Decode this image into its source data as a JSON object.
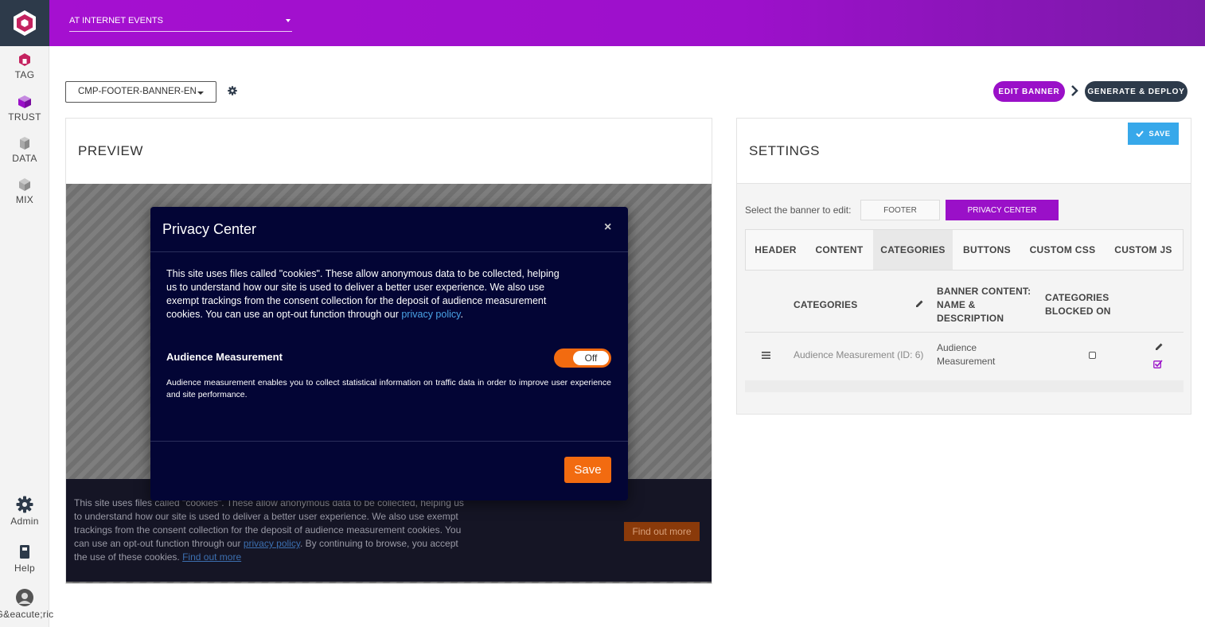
{
  "sidebar": {
    "items": [
      {
        "label": "TAG",
        "icon": "tag-hexagon-icon",
        "color": "#c4225f"
      },
      {
        "label": "TRUST",
        "icon": "trust-cube-icon",
        "color": "#9a10c8"
      },
      {
        "label": "DATA",
        "icon": "data-cube-icon",
        "color": "#999999"
      },
      {
        "label": "MIX",
        "icon": "mix-cube-icon",
        "color": "#999999"
      }
    ],
    "bottom": [
      {
        "label": "Admin",
        "icon": "gear-icon"
      },
      {
        "label": "Help",
        "icon": "book-icon"
      },
      {
        "label": "G&eacute;ric",
        "icon": "avatar"
      }
    ]
  },
  "topbar": {
    "site_selector": "AT INTERNET EVENTS"
  },
  "toolbar": {
    "banner_selector": "CMP-FOOTER-BANNER-EN",
    "steps": [
      "EDIT BANNER",
      "GENERATE & DEPLOY"
    ]
  },
  "preview": {
    "title": "PREVIEW",
    "modal": {
      "title": "Privacy Center",
      "close": "×",
      "intro_before_link": "This site uses files called \"cookies\". These allow anonymous data to be collected, helping us to understand how our site is used to deliver a better user experience. We also use exempt trackings from the consent collection for the deposit of audience measurement cookies. You can use an opt-out function through our ",
      "intro_link": "privacy policy",
      "intro_after_link": ".",
      "category_name": "Audience Measurement",
      "toggle_label": "Off",
      "category_description": "Audience measurement enables you to collect statistical information on traffic data in order to improve user experience and site performance.",
      "save": "Save"
    },
    "footer_banner": {
      "text_1": "This site uses files called \"cookies\". These allow anonymous data to be collected, helping us to understand how our site is used to deliver a better user experience. We also use exempt trackings from the consent collection for the deposit of audience measurement cookies. You can use an opt-out function through our ",
      "privacy_link": "privacy policy",
      "text_2": ". By continuing to browse, you accept the use of these cookies. ",
      "find_link": "Find out more",
      "button": "Find out more"
    }
  },
  "settings": {
    "title": "SETTINGS",
    "save": "SAVE",
    "select_label": "Select the banner to edit:",
    "banner_buttons": [
      "FOOTER",
      "PRIVACY CENTER"
    ],
    "tabs": [
      "HEADER",
      "CONTENT",
      "CATEGORIES",
      "BUTTONS",
      "CUSTOM CSS",
      "CUSTOM JS"
    ],
    "active_tab": "CATEGORIES",
    "table": {
      "headers": {
        "categories": "CATEGORIES",
        "banner_content_1": "BANNER CONTENT:",
        "banner_content_2": "NAME &",
        "banner_content_3": "DESCRIPTION",
        "blocked_1": "CATEGORIES",
        "blocked_2": "BLOCKED ON"
      },
      "rows": [
        {
          "category": "Audience Measurement (ID: 6)",
          "content_1": "Audience",
          "content_2": "Measurement",
          "blocked": false
        }
      ]
    }
  }
}
